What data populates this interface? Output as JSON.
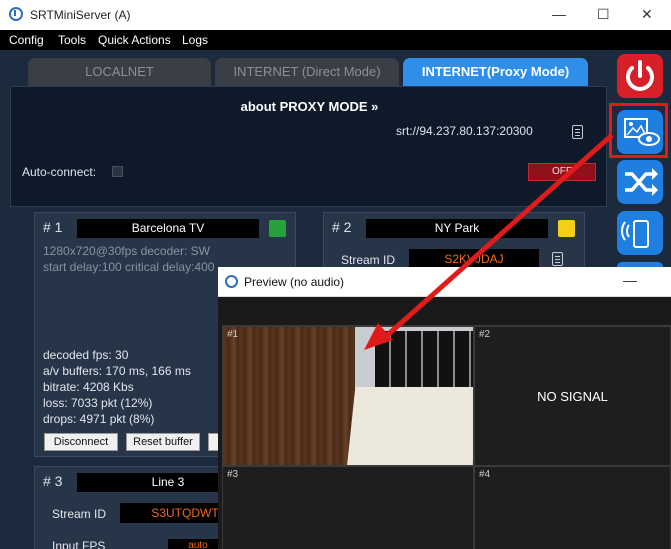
{
  "window": {
    "title": "SRTMiniServer (A)",
    "minimize": "—",
    "maximize": "☐",
    "close": "✕"
  },
  "menu": [
    "Config",
    "Tools",
    "Quick Actions",
    "Logs"
  ],
  "tabs": [
    {
      "label": "LOCALNET",
      "active": false
    },
    {
      "label": "INTERNET (Direct Mode)",
      "active": false
    },
    {
      "label": "INTERNET(Proxy Mode)",
      "active": true
    }
  ],
  "proxy": {
    "about": "about PROXY MODE »",
    "srt_url": "srt://94.237.80.137:20300",
    "autoconnect_label": "Auto-connect:",
    "off_label": "OFF"
  },
  "side_buttons": [
    "power-icon",
    "preview-eye-icon",
    "shuffle-icon",
    "phone-icon"
  ],
  "cards": {
    "card1": {
      "num": "# 1",
      "name": "Barcelona TV",
      "led_color": "#27a13a",
      "meta": [
        "1280x720@30fps  decoder: SW",
        "start delay:100  critical delay:400"
      ],
      "stats": [
        "decoded fps: 30",
        "a/v buffers: 170 ms, 166 ms",
        "bitrate: 4208 Kbs",
        "loss: 7033 pkt (12%)",
        "drops: 4971 pkt (8%)"
      ],
      "disconnect": "Disconnect",
      "reset": "Reset buffer"
    },
    "card2": {
      "num": "# 2",
      "name": "NY Park",
      "led_color": "#f3cf19",
      "stream_id_label": "Stream ID",
      "stream_id": "S2KVJDAJ"
    },
    "card3": {
      "num": "# 3",
      "name": "Line 3",
      "stream_id_label": "Stream ID",
      "stream_id": "S3UTQDWT",
      "input_fps_label": "Input FPS",
      "input_fps_value": "auto"
    }
  },
  "preview": {
    "title": "Preview (no audio)",
    "minimize": "—",
    "quads": [
      {
        "label": "#1",
        "signal": true
      },
      {
        "label": "#2",
        "signal": false,
        "text": "NO SIGNAL"
      },
      {
        "label": "#3",
        "signal": false
      },
      {
        "label": "#4",
        "signal": false
      }
    ]
  },
  "colors": {
    "accent": "#2f8ee8",
    "highlight": "#e01b1b",
    "off_toggle": "#8f1119",
    "stream_id_text": "#ef6a1e"
  }
}
